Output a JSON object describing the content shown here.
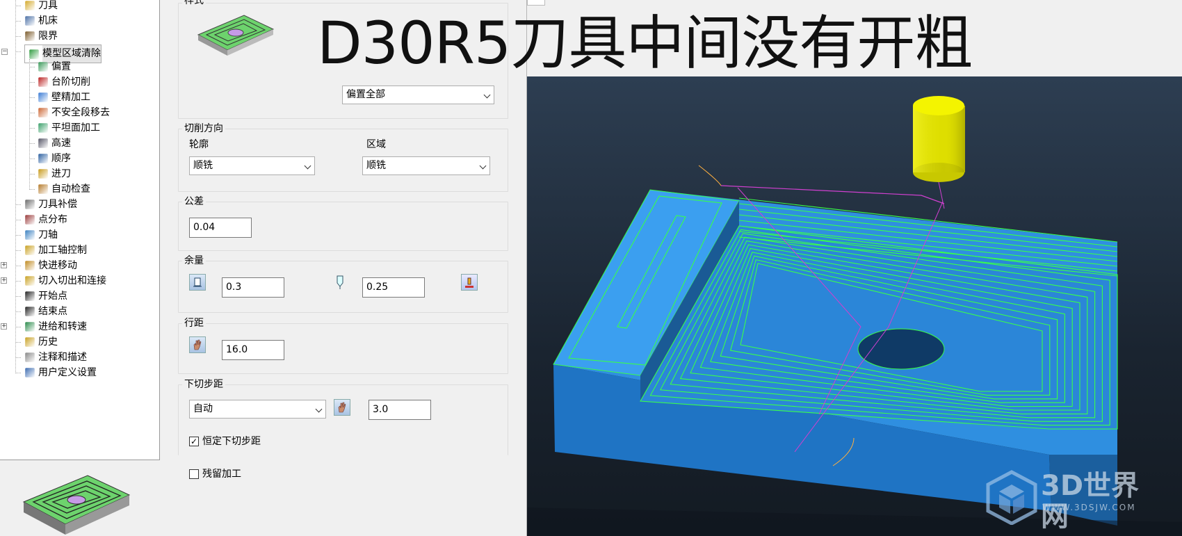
{
  "title_overlay": "D30R5刀具中间没有开粗",
  "tree": {
    "items": [
      {
        "label": "刀具",
        "icon": "tool-icon"
      },
      {
        "label": "机床",
        "icon": "machine-icon"
      },
      {
        "label": "限界",
        "icon": "limits-icon"
      },
      {
        "label": "模型区域清除",
        "icon": "model-area-clearance-icon"
      },
      {
        "label": "偏置",
        "icon": "offset-icon"
      },
      {
        "label": "台阶切削",
        "icon": "step-cutting-icon"
      },
      {
        "label": "壁精加工",
        "icon": "wall-finishing-icon"
      },
      {
        "label": "不安全段移去",
        "icon": "unsafe-segment-removal-icon"
      },
      {
        "label": "平坦面加工",
        "icon": "flat-machining-icon"
      },
      {
        "label": "高速",
        "icon": "high-speed-icon"
      },
      {
        "label": "顺序",
        "icon": "order-icon"
      },
      {
        "label": "进刀",
        "icon": "plunge-icon"
      },
      {
        "label": "自动检查",
        "icon": "auto-verify-icon"
      },
      {
        "label": "刀具补偿",
        "icon": "tool-compensation-icon"
      },
      {
        "label": "点分布",
        "icon": "point-distribution-icon"
      },
      {
        "label": "刀轴",
        "icon": "tool-axis-icon"
      },
      {
        "label": "加工轴控制",
        "icon": "axis-control-icon"
      },
      {
        "label": "快进移动",
        "icon": "rapid-move-icon"
      },
      {
        "label": "切入切出和连接",
        "icon": "leads-links-icon"
      },
      {
        "label": "开始点",
        "icon": "start-point-icon"
      },
      {
        "label": "结束点",
        "icon": "end-point-icon"
      },
      {
        "label": "进给和转速",
        "icon": "feeds-speeds-icon"
      },
      {
        "label": "历史",
        "icon": "history-icon"
      },
      {
        "label": "注释和描述",
        "icon": "notes-icon"
      },
      {
        "label": "用户定义设置",
        "icon": "user-settings-icon"
      }
    ]
  },
  "dialog": {
    "style_group": "样式",
    "style_select": "偏置全部",
    "cut_direction": {
      "group": "切削方向",
      "profile_label": "轮廓",
      "profile_value": "顺铣",
      "area_label": "区域",
      "area_value": "顺铣"
    },
    "tolerance": {
      "group": "公差",
      "value": "0.04"
    },
    "allowance": {
      "group": "余量",
      "radial": "0.3",
      "axial": "0.25"
    },
    "stepover": {
      "group": "行距",
      "value": "16.0"
    },
    "stepdown": {
      "group": "下切步距",
      "mode": "自动",
      "value": "3.0",
      "constant_label": "恒定下切步距",
      "constant_checked": true
    },
    "rest_label": "残留加工",
    "rest_checked": false
  },
  "watermark": {
    "name": "3D世界网",
    "url": "WWW.3DSJW.COM"
  },
  "colors": {
    "stock": "#2f8fe0",
    "toolpath": "#39ff4a",
    "tool": "#e6e600",
    "link": "#d040d0"
  }
}
